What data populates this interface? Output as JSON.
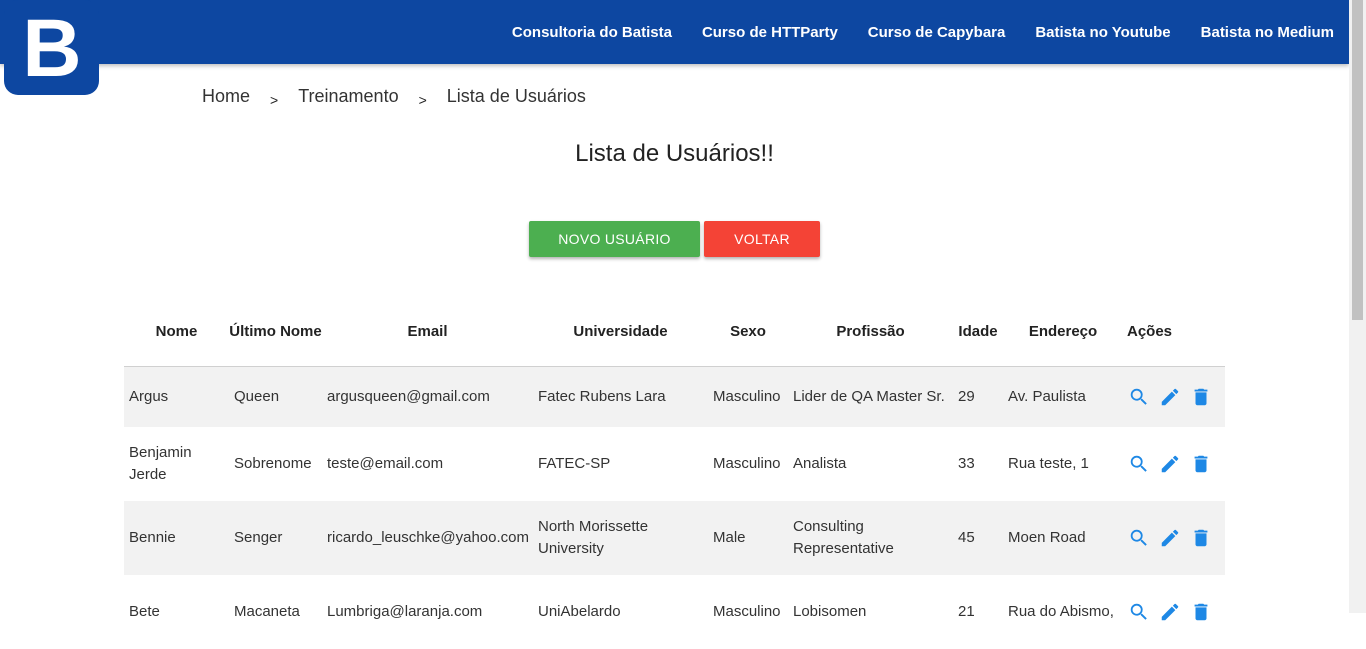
{
  "nav": {
    "logo_letter": "B",
    "links": [
      {
        "label": "Consultoria do Batista"
      },
      {
        "label": "Curso de HTTParty"
      },
      {
        "label": "Curso de Capybara"
      },
      {
        "label": "Batista no Youtube"
      },
      {
        "label": "Batista no Medium"
      }
    ]
  },
  "breadcrumb": {
    "items": [
      "Home",
      "Treinamento",
      "Lista de Usuários"
    ],
    "separator": ">"
  },
  "page": {
    "title": "Lista de Usuários!!"
  },
  "buttons": {
    "new_user": "NOVO USUÁRIO",
    "back": "VOLTAR"
  },
  "table": {
    "columns": [
      "Nome",
      "Último Nome",
      "Email",
      "Universidade",
      "Sexo",
      "Profissão",
      "Idade",
      "Endereço",
      "Ações"
    ],
    "rows": [
      {
        "nome": "Argus",
        "ultimo_nome": "Queen",
        "email": "argusqueen@gmail.com",
        "universidade": "Fatec Rubens Lara",
        "sexo": "Masculino",
        "profissao": "Lider de QA Master Sr.",
        "idade": "29",
        "endereco": "Av. Paulista"
      },
      {
        "nome": "Benjamin Jerde",
        "ultimo_nome": "Sobrenome",
        "email": "teste@email.com",
        "universidade": "FATEC-SP",
        "sexo": "Masculino",
        "profissao": "Analista",
        "idade": "33",
        "endereco": "Rua teste, 1"
      },
      {
        "nome": "Bennie",
        "ultimo_nome": "Senger",
        "email": "ricardo_leuschke@yahoo.com",
        "universidade": "North Morissette University",
        "sexo": "Male",
        "profissao": "Consulting Representative",
        "idade": "45",
        "endereco": "Moen Road"
      },
      {
        "nome": "Bete",
        "ultimo_nome": "Macaneta",
        "email": "Lumbriga@laranja.com",
        "universidade": "UniAbelardo",
        "sexo": "Masculino",
        "profissao": "Lobisomen",
        "idade": "21",
        "endereco": "Rua do Abismo,"
      }
    ]
  },
  "colors": {
    "nav_bg": "#0d47a1",
    "new_user_button": "#4caf50",
    "back_button": "#f44336",
    "action_icons": "#1e88e5"
  },
  "icons": {
    "view": "search-icon",
    "edit": "pencil-icon",
    "delete": "trash-icon"
  }
}
